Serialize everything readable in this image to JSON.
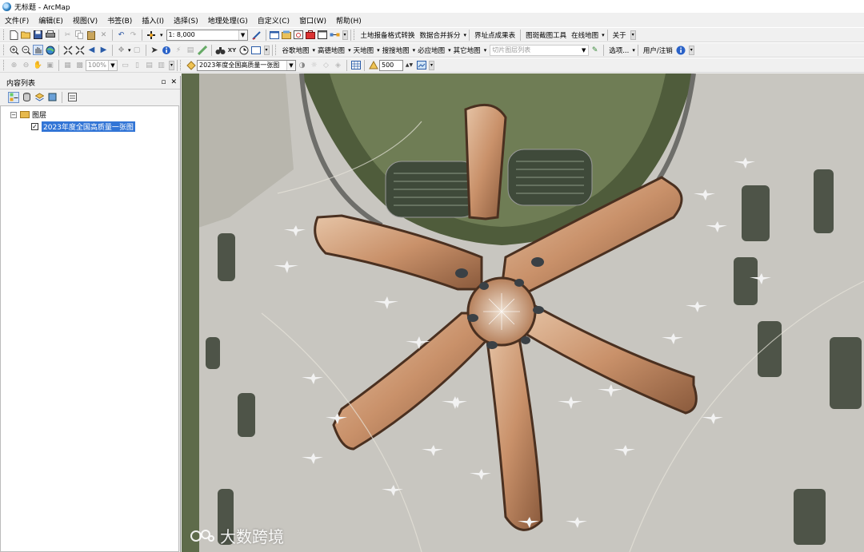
{
  "window": {
    "title": "无标题 - ArcMap"
  },
  "menubar": {
    "items": [
      "文件(F)",
      "编辑(E)",
      "视图(V)",
      "书签(B)",
      "插入(I)",
      "选择(S)",
      "地理处理(G)",
      "自定义(C)",
      "窗口(W)",
      "帮助(H)"
    ]
  },
  "toolbar1": {
    "scale_value": "1: 8,000",
    "text_buttons": [
      "土地报备格式转换",
      "数据合并拆分",
      "界址点成果表",
      "图斑截图工具",
      "在线地图",
      "关于"
    ]
  },
  "toolbar2": {
    "text_buttons": [
      "谷歌地图",
      "高德地图",
      "天地图",
      "搜搜地图",
      "必应地图",
      "其它地图"
    ],
    "tile_layer_placeholder": "切片图层列表",
    "options_label": "选项...",
    "user_label": "用户/注销"
  },
  "toolbar3": {
    "zoom_value": "100%",
    "layer_select": "2023年度全国高质量一张图",
    "resolution_value": "500"
  },
  "toc": {
    "title": "内容列表",
    "root_label": "图层",
    "layer_label": "2023年度全国高质量一张图",
    "layer_checked": "✓"
  },
  "watermark": {
    "text": "大数跨境"
  },
  "colors": {
    "accent": "#3275d6",
    "terminal": "#c9916a",
    "apron": "#c8c6c0"
  }
}
